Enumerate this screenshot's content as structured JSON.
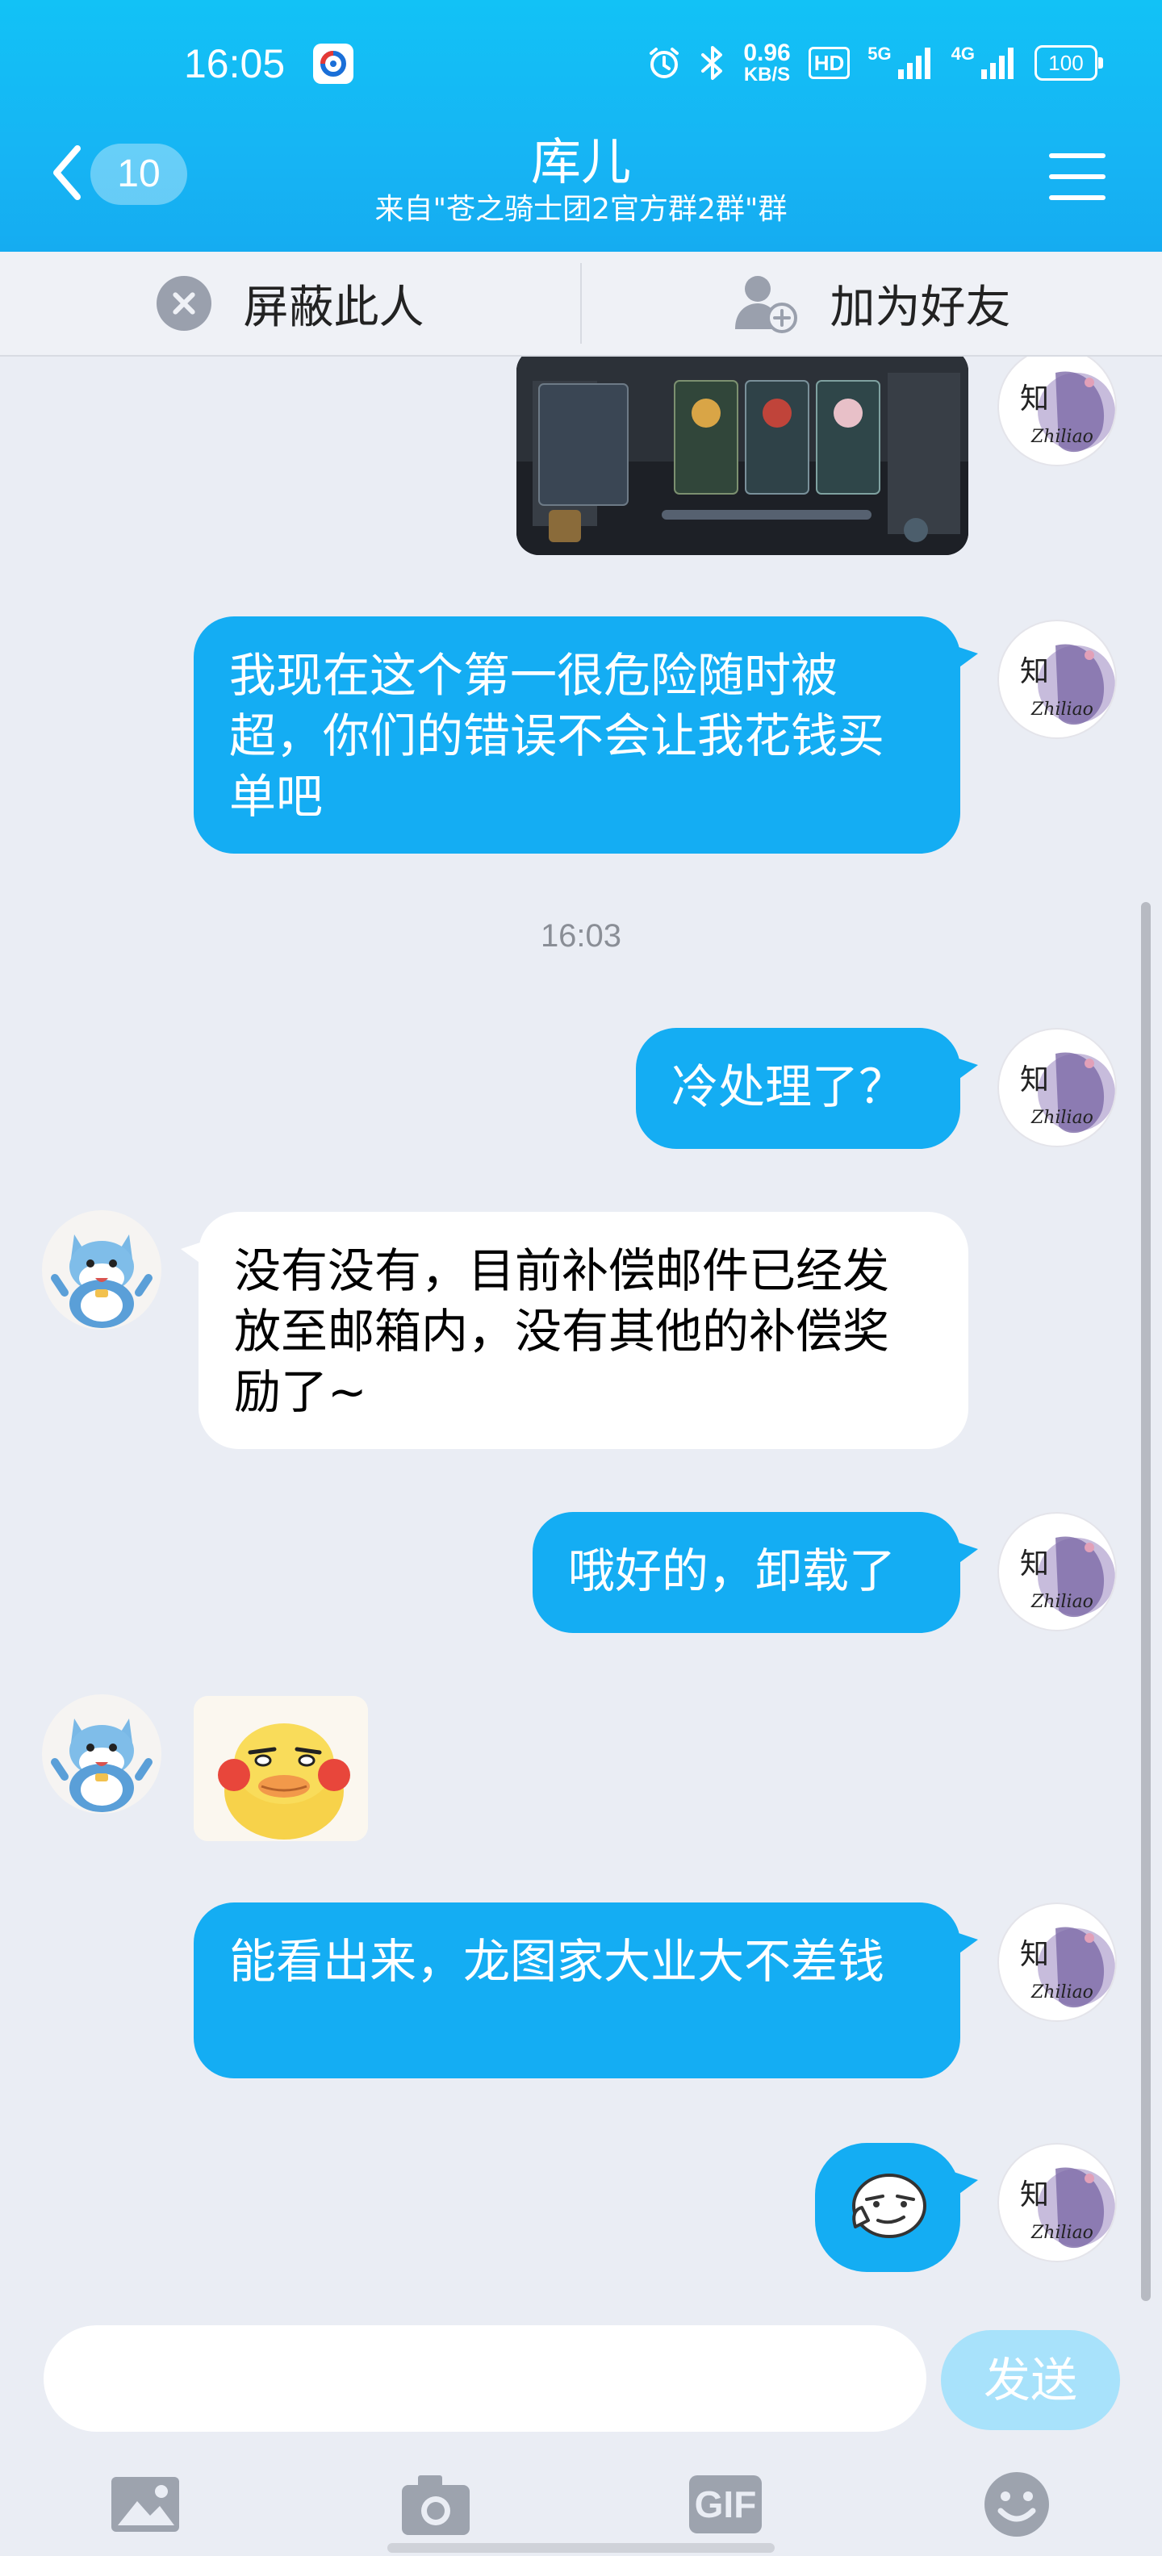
{
  "status_bar": {
    "time": "16:05",
    "net_speed_value": "0.96",
    "net_speed_unit": "KB/S",
    "hd_label": "HD",
    "sim1_label": "5G",
    "sim2_label": "4G",
    "battery_level": "100"
  },
  "header": {
    "unread_count": "10",
    "title": "库儿",
    "subtitle": "来自\"苍之骑士团2官方群2群\"群"
  },
  "action_bar": {
    "block_label": "屏蔽此人",
    "add_friend_label": "加为好友"
  },
  "messages": [
    {
      "sender": "me",
      "type": "image"
    },
    {
      "sender": "me",
      "type": "text",
      "text": "我现在这个第一很危险随时被超，你们的错误不会让我花钱买单吧"
    },
    {
      "type": "timestamp",
      "text": "16:03"
    },
    {
      "sender": "me",
      "type": "text",
      "text": "冷处理了？"
    },
    {
      "sender": "other",
      "type": "text",
      "text": "没有没有，目前补偿邮件已经发放至邮箱内，没有其他的补偿奖励了~"
    },
    {
      "sender": "me",
      "type": "text",
      "text": "哦好的，卸载了"
    },
    {
      "sender": "other",
      "type": "sticker"
    },
    {
      "sender": "me",
      "type": "text",
      "text": "能看出来，龙图家大业大不差钱"
    },
    {
      "sender": "me",
      "type": "emoji"
    }
  ],
  "composer": {
    "input_value": "",
    "send_label": "发送"
  },
  "toolbar": {
    "gif_label": "GIF"
  },
  "colors": {
    "header_top": "#12c2f6",
    "header_bottom": "#15acf1",
    "bubble_me": "#14adf3",
    "bubble_other": "#ffffff",
    "chat_bg": "#eaedf4",
    "send_button": "#a8e2fb"
  },
  "icons": {
    "back": "chevron-left-icon",
    "menu": "hamburger-menu-icon",
    "block": "block-user-icon",
    "add_friend": "add-friend-icon",
    "image": "image-icon",
    "camera": "camera-icon",
    "gif": "gif-icon",
    "emoji": "emoji-icon"
  }
}
